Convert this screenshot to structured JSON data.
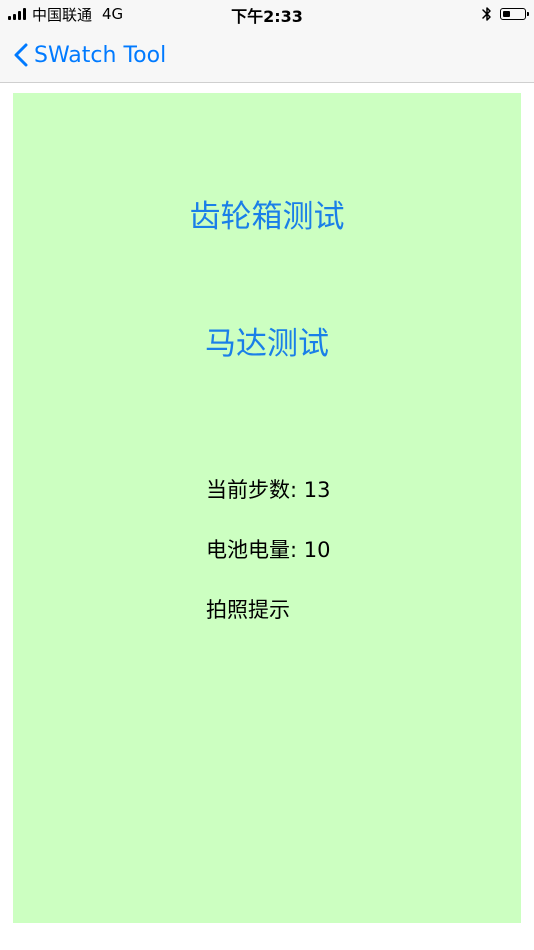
{
  "status_bar": {
    "carrier": "中国联通",
    "network": "4G",
    "time": "下午2:33",
    "battery_level": 0.35
  },
  "nav": {
    "back_label": "SWatch Tool"
  },
  "panel": {
    "gearbox_test_label": "齿轮箱测试",
    "motor_test_label": "马达测试",
    "steps_label": "当前步数: 13",
    "battery_label": "电池电量: 10",
    "photo_hint_label": "拍照提示"
  },
  "colors": {
    "accent": "#007aff",
    "panel_bg": "#ccffc1",
    "button_text": "#1a7fe8"
  }
}
